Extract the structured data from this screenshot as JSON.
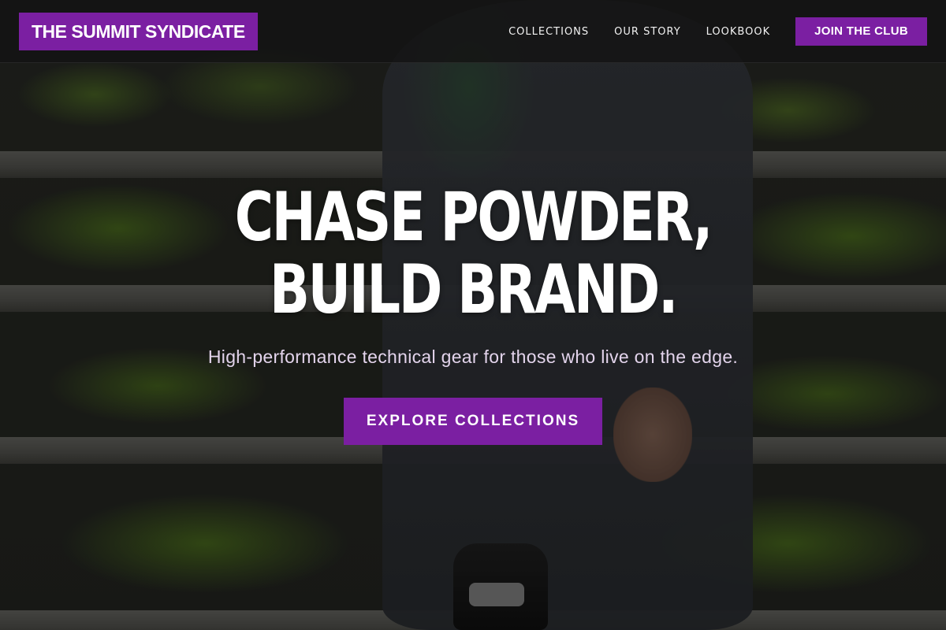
{
  "header": {
    "logo": "THE SUMMIT SYNDICATE",
    "nav": [
      {
        "label": "COLLECTIONS"
      },
      {
        "label": "OUR STORY"
      },
      {
        "label": "LOOKBOOK"
      }
    ],
    "cta_label": "JOIN THE CLUB"
  },
  "hero": {
    "title_line1": "CHASE POWDER,",
    "title_line2": "BUILD BRAND.",
    "subtitle": "High-performance technical gear for those who live on the edge.",
    "cta_label": "EXPLORE COLLECTIONS"
  },
  "theme": {
    "accent": "#7b1fa2",
    "header_bg": "#141414",
    "subtitle_color": "#e3d4ec"
  }
}
